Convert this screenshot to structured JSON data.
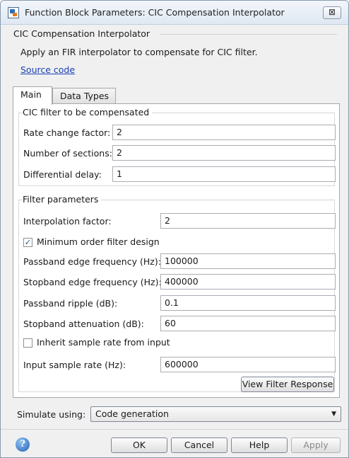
{
  "window": {
    "title": "Function Block Parameters: CIC Compensation Interpolator",
    "close_label": "⊠"
  },
  "block": {
    "name": "CIC Compensation Interpolator",
    "description": "Apply an FIR interpolator to compensate for CIC filter.",
    "source_link": "Source code"
  },
  "tabs": [
    {
      "label": "Main",
      "active": true
    },
    {
      "label": "Data Types",
      "active": false
    }
  ],
  "cic_group": {
    "title": "CIC filter to be compensated",
    "rate_change_label": "Rate change factor:",
    "rate_change_value": "2",
    "num_sections_label": "Number of sections:",
    "num_sections_value": "2",
    "diff_delay_label": "Differential delay:",
    "diff_delay_value": "1"
  },
  "filter_group": {
    "title": "Filter parameters",
    "interp_label": "Interpolation factor:",
    "interp_value": "2",
    "min_order_label": "Minimum order filter design",
    "min_order_checked": true,
    "passband_edge_label": "Passband edge frequency (Hz):",
    "passband_edge_value": "100000",
    "stopband_edge_label": "Stopband edge frequency (Hz):",
    "stopband_edge_value": "400000",
    "passband_ripple_label": "Passband ripple (dB):",
    "passband_ripple_value": "0.1",
    "stopband_atten_label": "Stopband attenuation (dB):",
    "stopband_atten_value": "60",
    "inherit_rate_label": "Inherit sample rate from input",
    "inherit_rate_checked": false,
    "input_rate_label": "Input sample rate (Hz):",
    "input_rate_value": "600000",
    "view_response_label": "View Filter Response"
  },
  "simulate": {
    "label": "Simulate using:",
    "selected": "Code generation"
  },
  "buttons": {
    "ok": "OK",
    "cancel": "Cancel",
    "help": "Help",
    "apply": "Apply"
  },
  "icons": {
    "help": "?",
    "check": "✓",
    "dropdown": "▼"
  }
}
